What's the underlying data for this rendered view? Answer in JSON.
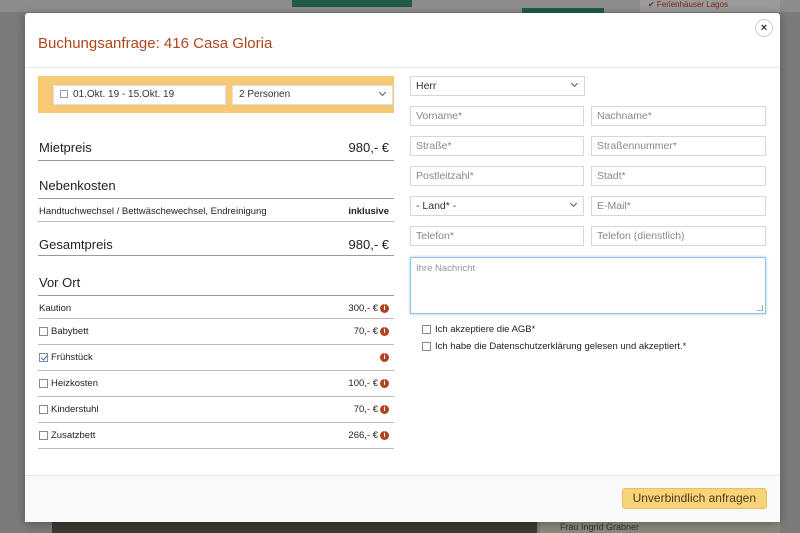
{
  "background": {
    "side_text": "✔ Ferienhäuser Lagos",
    "bottom_text": "Frau Ingrid Grabner"
  },
  "modal": {
    "title": "Buchungsanfrage: 416 Casa Gloria",
    "close_label": "×"
  },
  "booking": {
    "date_range": "01.Okt. 19 - 15.Okt. 19",
    "persons": "2 Personen"
  },
  "prices": {
    "mietpreis_label": "Mietpreis",
    "mietpreis_value": "980,- €",
    "nebenkosten_label": "Nebenkosten",
    "nebenkosten_item": "Handtuchwechsel / Bettwäschewechsel, Endreinigung",
    "nebenkosten_value": "inklusive",
    "gesamt_label": "Gesamtpreis",
    "gesamt_value": "980,- €",
    "vor_ort_label": "Vor Ort",
    "kaution_label": "Kaution",
    "kaution_value": "300,- €"
  },
  "extras": [
    {
      "label": "Babybett",
      "value": "70,- €",
      "checked": false
    },
    {
      "label": "Frühstück",
      "value": "",
      "checked": true
    },
    {
      "label": "Heizkosten",
      "value": "100,- €",
      "checked": false
    },
    {
      "label": "Kinderstuhl",
      "value": "70,- €",
      "checked": false
    },
    {
      "label": "Zusatzbett",
      "value": "266,- €",
      "checked": false
    }
  ],
  "form": {
    "salutation": "Herr",
    "vorname": "Vorname*",
    "nachname": "Nachname*",
    "strasse": "Straße*",
    "strassennummer": "Straßennummer*",
    "plz": "Postleitzahl*",
    "stadt": "Stadt*",
    "land": "- Land* -",
    "email": "E-Mail*",
    "telefon": "Telefon*",
    "telefon_dienst": "Telefon (dienstlich)",
    "nachricht": "Ihre Nachricht",
    "agb_text": "Ich akzeptiere die AGB*",
    "datenschutz_text": "Ich habe die Datenschutzerklärung gelesen und akzeptiert.*"
  },
  "footer": {
    "submit_label": "Unverbindlich anfragen"
  },
  "colors": {
    "accent": "#b0451d",
    "booking_bg": "#f7c975",
    "submit_bg": "#f7d37a"
  }
}
